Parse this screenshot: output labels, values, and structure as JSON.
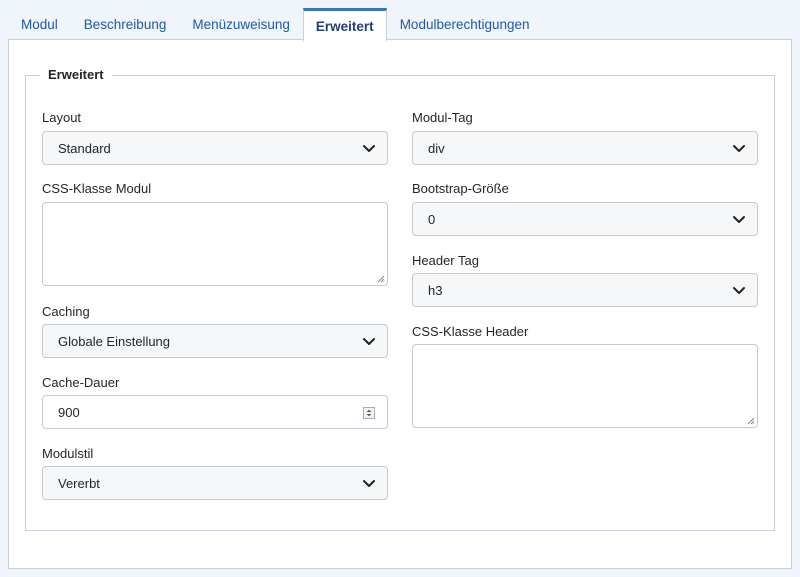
{
  "tabs": [
    {
      "label": "Modul"
    },
    {
      "label": "Beschreibung"
    },
    {
      "label": "Menüzuweisung"
    },
    {
      "label": "Erweitert"
    },
    {
      "label": "Modulberechtigungen"
    }
  ],
  "active_tab": "Erweitert",
  "fieldset": {
    "legend": "Erweitert"
  },
  "left": {
    "layout": {
      "label": "Layout",
      "value": "Standard"
    },
    "css_class_module": {
      "label": "CSS-Klasse Modul",
      "value": ""
    },
    "caching": {
      "label": "Caching",
      "value": "Globale Einstellung"
    },
    "cache_duration": {
      "label": "Cache-Dauer",
      "value": "900"
    },
    "module_style": {
      "label": "Modulstil",
      "value": "Vererbt"
    }
  },
  "right": {
    "module_tag": {
      "label": "Modul-Tag",
      "value": "div"
    },
    "bootstrap_size": {
      "label": "Bootstrap-Größe",
      "value": "0"
    },
    "header_tag": {
      "label": "Header Tag",
      "value": "h3"
    },
    "css_class_header": {
      "label": "CSS-Klasse Header",
      "value": ""
    }
  },
  "icons": {
    "select_arrow": "chevron-down-icon",
    "number_spinner": "spinner-icon",
    "resize": "resize-grip-icon"
  },
  "colors": {
    "tab_text": "#1f58a6",
    "active_tab_border": "#3b72b8",
    "page_background": "#f0f4fb"
  }
}
